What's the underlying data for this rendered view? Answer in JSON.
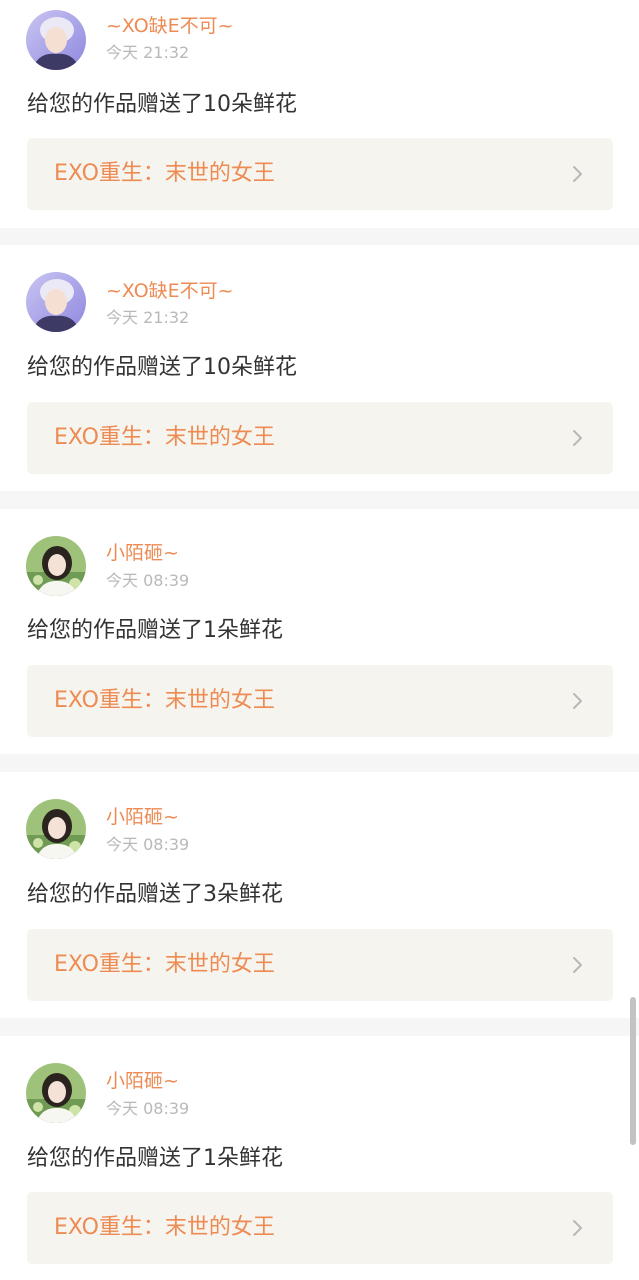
{
  "notifications": [
    {
      "user": "~XO缺E不可~",
      "time": "今天 21:32",
      "message": "给您的作品赠送了10朵鲜花",
      "work_title": "EXO重生：末世的女王",
      "avatar_style": "purple-male"
    },
    {
      "user": "~XO缺E不可~",
      "time": "今天 21:32",
      "message": "给您的作品赠送了10朵鲜花",
      "work_title": "EXO重生：末世的女王",
      "avatar_style": "purple-male"
    },
    {
      "user": "小陌砸~",
      "time": "今天 08:39",
      "message": "给您的作品赠送了1朵鲜花",
      "work_title": "EXO重生：末世的女王",
      "avatar_style": "green-female"
    },
    {
      "user": "小陌砸~",
      "time": "今天 08:39",
      "message": "给您的作品赠送了3朵鲜花",
      "work_title": "EXO重生：末世的女王",
      "avatar_style": "green-female"
    },
    {
      "user": "小陌砸~",
      "time": "今天 08:39",
      "message": "给您的作品赠送了1朵鲜花",
      "work_title": "EXO重生：末世的女王",
      "avatar_style": "green-female"
    }
  ],
  "colors": {
    "accent": "#ee8b53",
    "timestamp": "#b9b9b9",
    "message_text": "#333333",
    "link_background": "#f5f4ee",
    "page_background": "#f6f6f6",
    "card_background": "#ffffff"
  },
  "icons": {
    "chevron": "chevron-right-icon",
    "avatar": "avatar"
  }
}
